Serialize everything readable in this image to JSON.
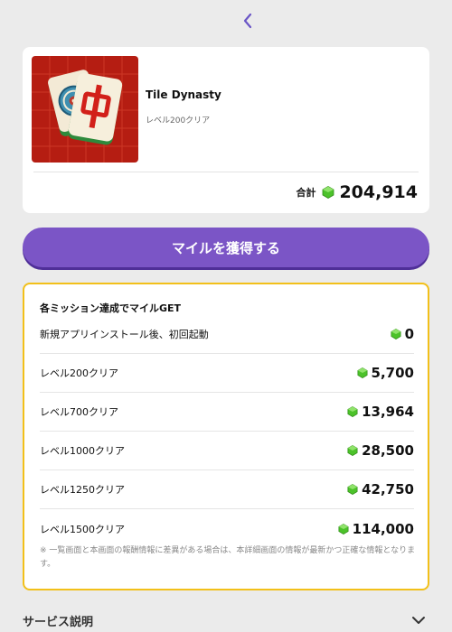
{
  "nav": {
    "back_icon": "chevron-left-icon"
  },
  "app": {
    "name": "Tile Dynasty",
    "subtitle": "レベル200クリア",
    "icon": "mahjong-tiles-icon",
    "total_label": "合計",
    "total_value": "204,914"
  },
  "cta": {
    "label": "マイルを獲得する"
  },
  "missions": {
    "title": "各ミッション達成でマイルGET",
    "items": [
      {
        "label": "新規アプリインストール後、初回起動",
        "value": "0"
      },
      {
        "label": "レベル200クリア",
        "value": "5,700"
      },
      {
        "label": "レベル700クリア",
        "value": "13,964"
      },
      {
        "label": "レベル1000クリア",
        "value": "28,500"
      },
      {
        "label": "レベル1250クリア",
        "value": "42,750"
      },
      {
        "label": "レベル1500クリア",
        "value": "114,000"
      }
    ],
    "note": "※ 一覧画面と本画面の報酬情報に差異がある場合は、本詳細画面の情報が最新かつ正確な情報となります。"
  },
  "service": {
    "title": "サービス説明",
    "chevron_icon": "chevron-down-icon"
  },
  "colors": {
    "background": "#ebebeb",
    "accent_purple": "#7b55c6",
    "mission_border": "#f2c01a",
    "gem_green": "#4cc22a",
    "back_arrow": "#6a55c6"
  }
}
